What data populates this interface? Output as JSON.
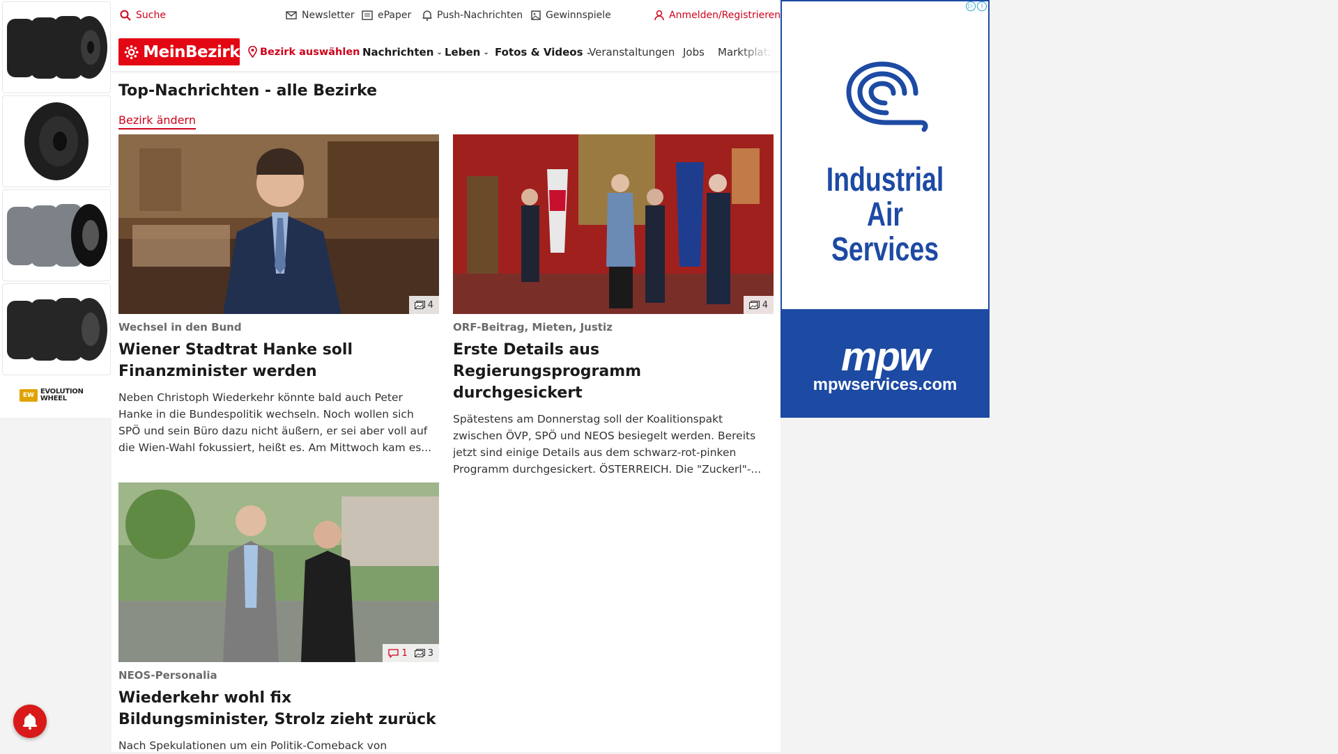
{
  "topbar": {
    "search": "Suche",
    "newsletter": "Newsletter",
    "epaper": "ePaper",
    "push": "Push-Nachrichten",
    "contests": "Gewinnspiele",
    "login": "Anmelden/Registrieren"
  },
  "nav": {
    "logo": "MeinBezirk",
    "district_select": "Bezirk auswählen",
    "items": [
      "Nachrichten",
      "Leben",
      "Fotos & Videos",
      "Veranstaltungen",
      "Jobs",
      "Marktplatz"
    ]
  },
  "main": {
    "title": "Top-Nachrichten - alle Bezirke",
    "change_district": "Bezirk ändern"
  },
  "articles": [
    {
      "kicker": "Wechsel in den Bund",
      "title": "Wiener Stadtrat Hanke soll Finanzminister werden",
      "teaser": "Neben Christoph Wiederkehr könnte bald auch Peter Hanke in die Bundespolitik wechseln. Noch wollen sich SPÖ und sein Büro dazu nicht äußern, er sei aber voll auf die Wien-Wahl fokussiert, heißt es. Am Mittwoch kam es...",
      "photos": "4"
    },
    {
      "kicker": "ORF-Beitrag, Mieten, Justiz",
      "title": "Erste Details aus Regierungsprogramm durchgesickert",
      "teaser": "Spätestens am Donnerstag soll der Koalitionspakt zwischen ÖVP, SPÖ und NEOS besiegelt werden. Bereits jetzt sind einige Details aus dem schwarz-rot-pinken Programm durchgesickert.  ÖSTERREICH. Die \"Zuckerl\"-...",
      "photos": "4"
    },
    {
      "kicker": "NEOS-Personalia",
      "title": "Wiederkehr wohl fix Bildungsminister, Strolz zieht zurück",
      "teaser": "Nach Spekulationen um ein Politik-Comeback von",
      "photos": "3",
      "comments": "1"
    }
  ],
  "ads": {
    "left_brand": "EVOLUTION WHEEL",
    "right_headline_1": "Industrial",
    "right_headline_2": "Air",
    "right_headline_3": "Services",
    "right_brand": "mpw",
    "right_url": "mpwservices.com"
  },
  "colors": {
    "brand_red": "#e30613",
    "link_red": "#d0021b",
    "ad_blue": "#1d4aa3"
  }
}
